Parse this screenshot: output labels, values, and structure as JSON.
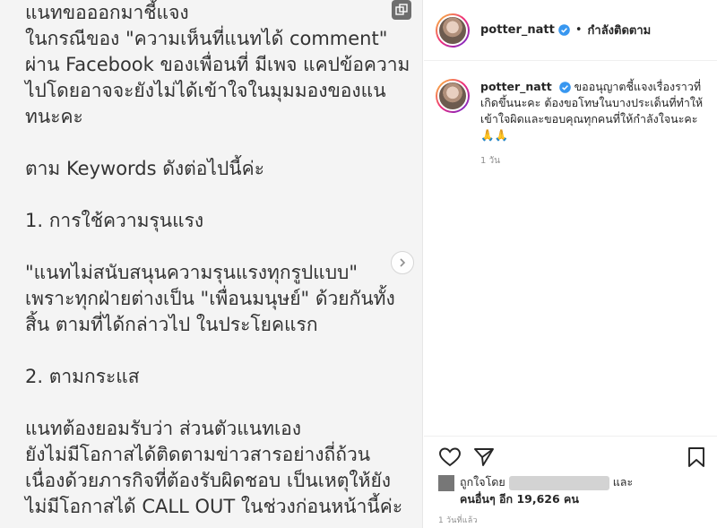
{
  "post": {
    "lines": [
      "แนทขอออกมาชี้แจง",
      "ในกรณีของ \"ความเห็นที่แนทได้ comment\"",
      "ผ่าน Facebook ของเพื่อนที่ มีเพจ แคปข้อความ",
      "ไปโดยอาจจะยังไม่ได้เข้าใจในมุมมองของแน",
      "ทนะคะ",
      "",
      "ตาม Keywords ดังต่อไปนี้ค่ะ",
      "",
      "1. การใช้ความรุนแรง",
      "",
      "\"แนทไม่สนับสนุนความรุนแรงทุกรูปแบบ\"",
      "เพราะทุกฝ่ายต่างเป็น \"เพื่อนมนุษย์\" ด้วยกันทั้ง",
      "สิ้น ตามที่ได้กล่าวไป ในประโยคแรก",
      "",
      "2. ตามกระแส",
      "",
      "แนทต้องยอมรับว่า ส่วนตัวแนทเอง",
      "ยังไม่มีโอกาสได้ติดตามข่าวสารอย่างถี่ถ้วน",
      "เนื่องด้วยภารกิจที่ต้องรับผิดชอบ เป็นเหตุให้ยัง",
      "ไม่มีโอกาสได้ CALL OUT ในช่วงก่อนหน้านี้ค่ะ"
    ]
  },
  "header": {
    "username": "potter_natt",
    "separator": "•",
    "follow_label": "กำลังติดตาม"
  },
  "caption": {
    "username": "potter_natt",
    "text": "ขออนุญาตชี้แจงเรื่องราวที่เกิดขึ้นนะคะ ต้องขอโทษในบางประเด็นที่ทำให้เข้าใจผิดและขอบคุณทุกคนที่ให้กำลังใจนะคะ 🙏🙏",
    "time": "1 วัน"
  },
  "likes": {
    "prefix": "ถูกใจโดย",
    "suffix": "และ",
    "others": "คนอื่นๆ อีก 19,626 คน"
  },
  "post_age": "1 วันที่แล้ว",
  "icons": [
    "multi-image-icon",
    "chevron-right-icon",
    "verified-icon",
    "heart-icon",
    "share-icon",
    "bookmark-icon"
  ],
  "colors": {
    "verified": "#3897f0",
    "text": "#262626",
    "muted": "#8e8e8e"
  }
}
